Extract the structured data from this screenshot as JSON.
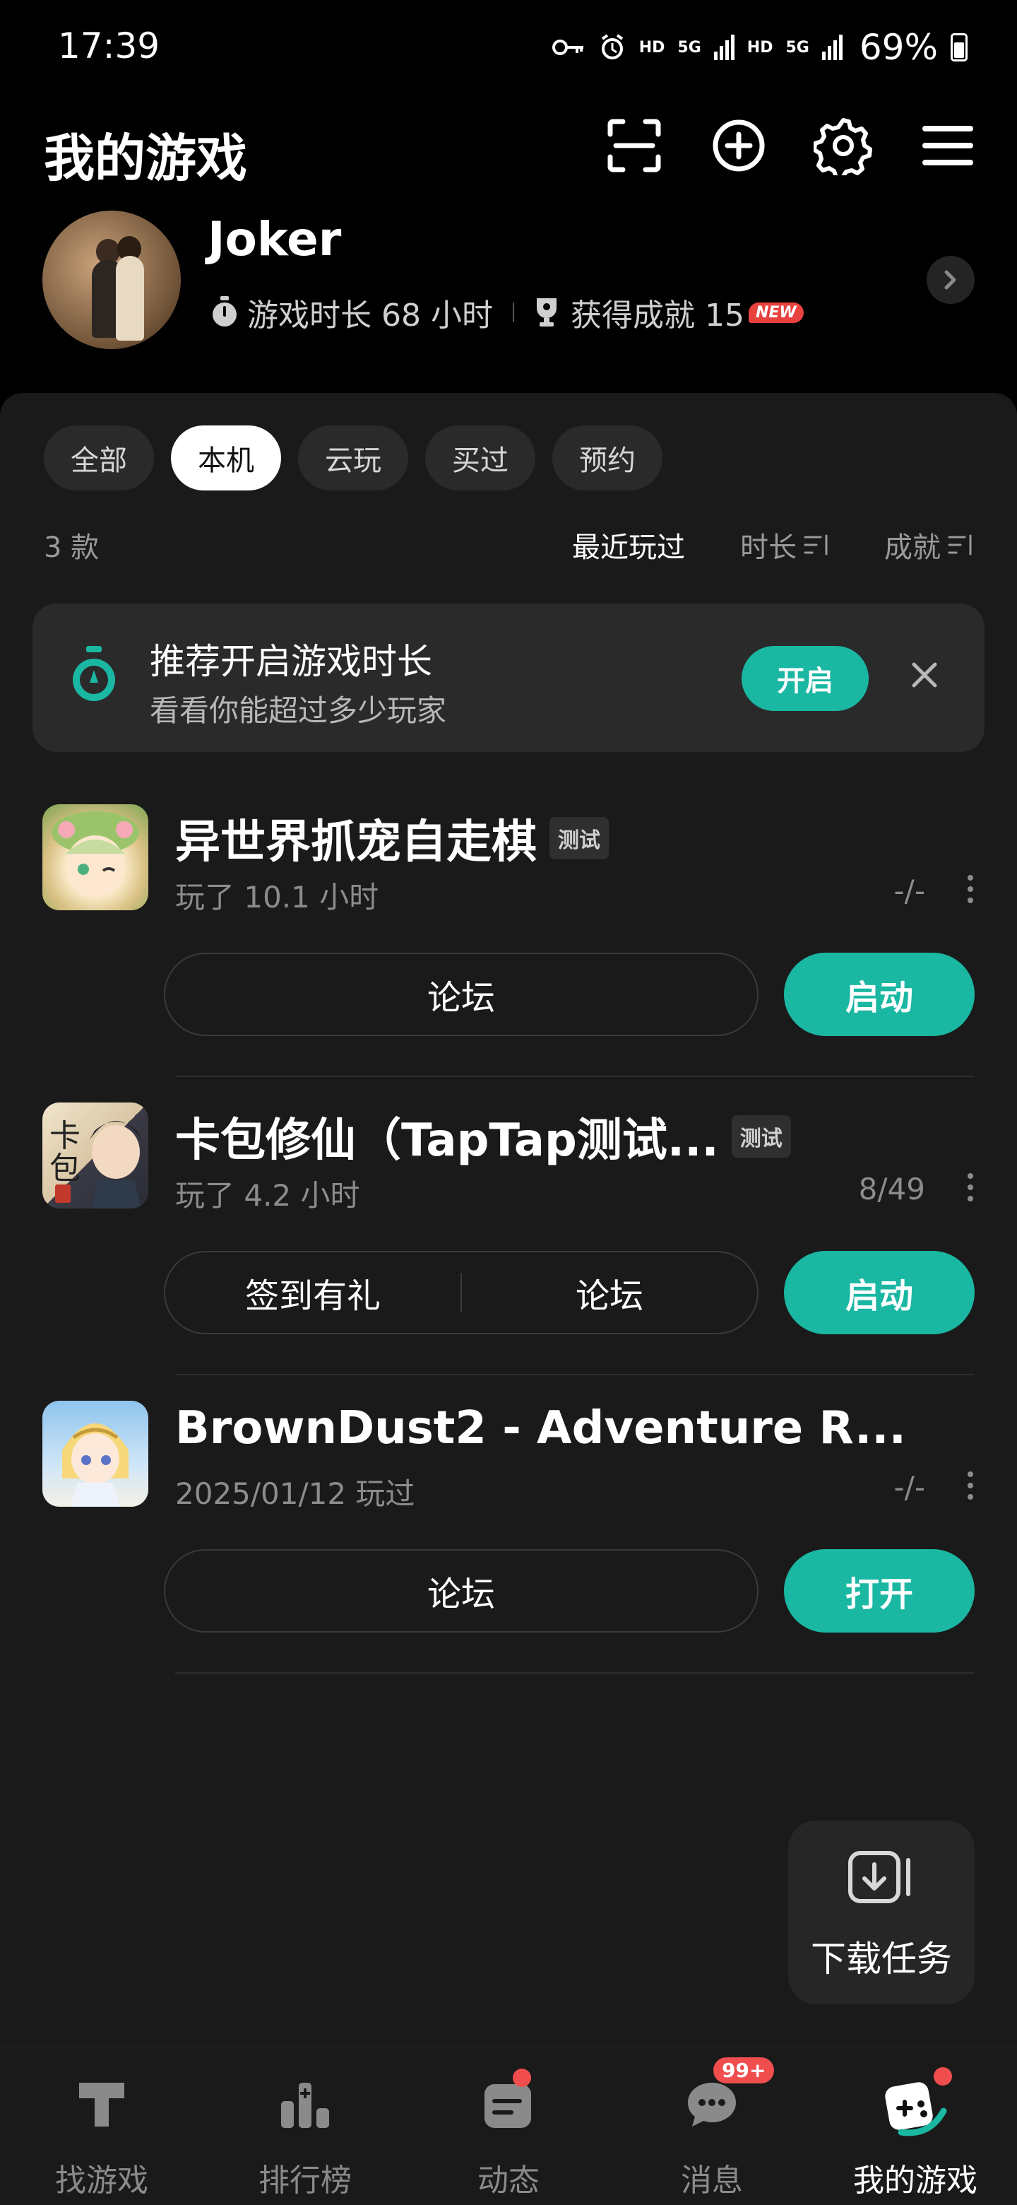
{
  "status_bar": {
    "time": "17:39",
    "hd1": "HD",
    "net1": "5G",
    "hd2": "HD",
    "net2": "5G",
    "battery_pct": "69%"
  },
  "header": {
    "title": "我的游戏",
    "actions": [
      "scan-icon",
      "add-icon",
      "settings-icon",
      "menu-icon"
    ]
  },
  "profile": {
    "name": "Joker",
    "playtime": "游戏时长 68 小时",
    "achievements": "获得成就 15",
    "new_badge": "NEW"
  },
  "filters": {
    "chips": [
      "全部",
      "本机",
      "云玩",
      "买过",
      "预约"
    ],
    "active": "本机",
    "count": "3 款",
    "sorts": [
      "最近玩过",
      "时长",
      "成就"
    ]
  },
  "banner": {
    "title": "推荐开启游戏时长",
    "subtitle": "看看你能超过多少玩家",
    "button": "开启"
  },
  "games": [
    {
      "name": "异世界抓宠自走棋",
      "tag": "测试",
      "meta": "玩了 10.1 小时",
      "stat": "-/-",
      "pill_segments": [
        "论坛"
      ],
      "action": "启动"
    },
    {
      "name": "卡包修仙（TapTap测试...",
      "tag": "测试",
      "meta": "玩了 4.2 小时",
      "stat": "8/49",
      "pill_segments": [
        "签到有礼",
        "论坛"
      ],
      "action": "启动"
    },
    {
      "name": "BrownDust2 - Adventure R...",
      "tag": "",
      "meta": "2025/01/12 玩过",
      "stat": "-/-",
      "pill_segments": [
        "论坛"
      ],
      "action": "打开"
    }
  ],
  "download": {
    "label": "下载任务"
  },
  "tabbar": {
    "tabs": [
      "找游戏",
      "排行榜",
      "动态",
      "消息",
      "我的游戏"
    ],
    "active": "我的游戏",
    "message_badge": "99+"
  },
  "colors": {
    "accent": "#1ab7a2",
    "badge": "#f04e4e",
    "panel": "#1a1a1a"
  }
}
